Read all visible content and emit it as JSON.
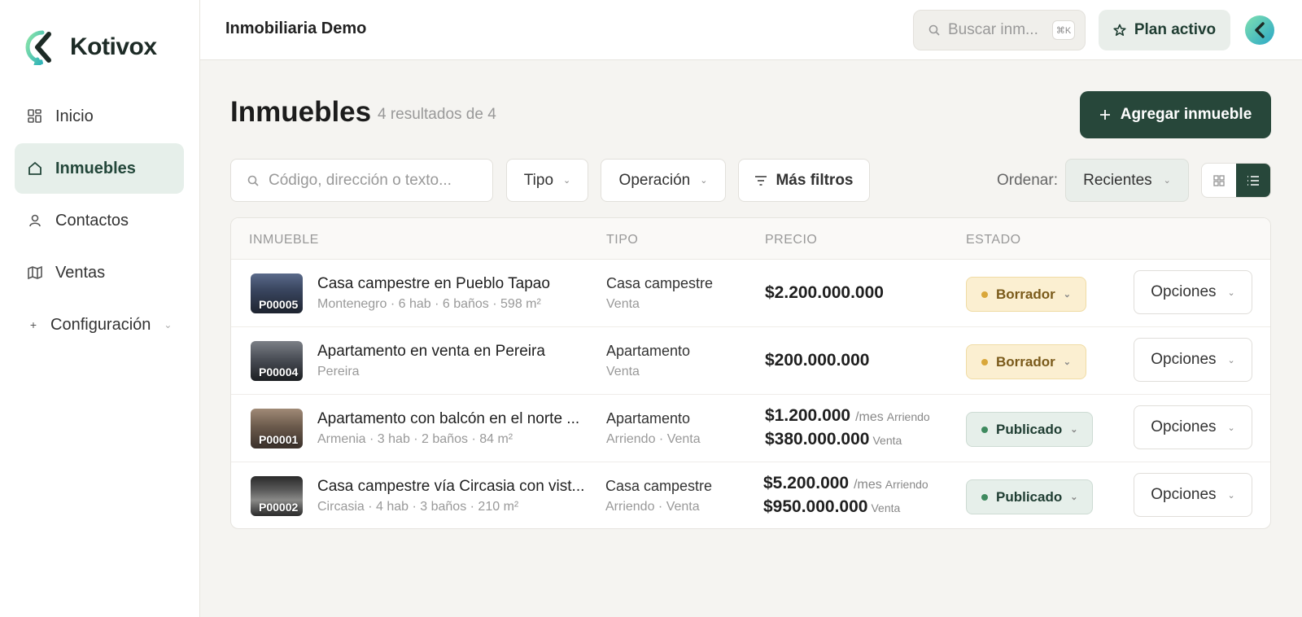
{
  "brand": {
    "name": "Kotivox"
  },
  "sidebar": {
    "items": [
      {
        "label": "Inicio",
        "icon": "dashboard-icon"
      },
      {
        "label": "Inmuebles",
        "icon": "home-icon"
      },
      {
        "label": "Contactos",
        "icon": "user-icon"
      },
      {
        "label": "Ventas",
        "icon": "sales-icon"
      },
      {
        "label": "Configuración",
        "icon": "plus-icon"
      }
    ]
  },
  "header": {
    "org": "Inmobiliaria Demo",
    "search_placeholder": "Buscar inm...",
    "shortcut": "⌘K",
    "plan_label": "Plan activo"
  },
  "main": {
    "title": "Inmuebles",
    "result_count": "4 resultados de 4",
    "add_label": "Agregar inmueble",
    "filters": {
      "search_placeholder": "Código, dirección o texto...",
      "type_label": "Tipo",
      "operation_label": "Operación",
      "more_label": "Más filtros",
      "order_label": "Ordenar:",
      "order_value": "Recientes"
    },
    "table": {
      "columns": [
        "INMUEBLE",
        "TIPO",
        "PRECIO",
        "ESTADO"
      ],
      "rows": [
        {
          "code": "P00005",
          "title": "Casa campestre en Pueblo Tapao",
          "subtitle": "Montenegro · 6 hab · 6 baños · 598 m²",
          "type": "Casa campestre",
          "operation": "Venta",
          "price": "$2.200.000.000",
          "status": "Borrador",
          "options": "Opciones"
        },
        {
          "code": "P00004",
          "title": "Apartamento en venta en Pereira",
          "subtitle": "Pereira",
          "type": "Apartamento",
          "operation": "Venta",
          "price": "$200.000.000",
          "status": "Borrador",
          "options": "Opciones"
        },
        {
          "code": "P00001",
          "title": "Apartamento con balcón en el norte ...",
          "subtitle": "Armenia · 3 hab · 2 baños · 84 m²",
          "type": "Apartamento",
          "operation": "Arriendo · Venta",
          "rent_price": "$1.200.000",
          "rent_unit": "/mes",
          "rent_label": "Arriendo",
          "sale_price": "$380.000.000",
          "sale_label": "Venta",
          "status": "Publicado",
          "options": "Opciones"
        },
        {
          "code": "P00002",
          "title": "Casa campestre vía Circasia con vist...",
          "subtitle": "Circasia · 4 hab · 3 baños · 210 m²",
          "type": "Casa campestre",
          "operation": "Arriendo · Venta",
          "rent_price": "$5.200.000",
          "rent_unit": "/mes",
          "rent_label": "Arriendo",
          "sale_price": "$950.000.000",
          "sale_label": "Venta",
          "status": "Publicado",
          "options": "Opciones"
        }
      ]
    }
  },
  "colors": {
    "accent": "#27473a",
    "active_bg": "#e6efea",
    "draft_bg": "#fbefd1",
    "draft_dot": "#d9a73a",
    "published_dot": "#3f8a5f"
  }
}
